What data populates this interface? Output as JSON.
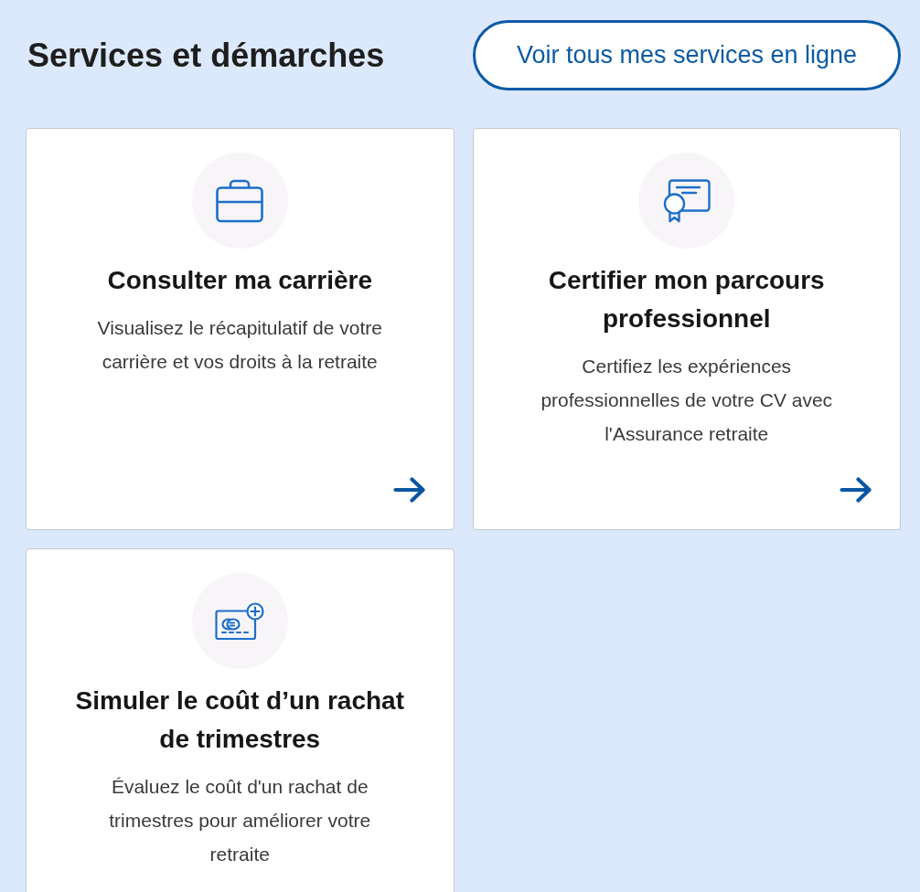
{
  "section": {
    "title": "Services et démarches",
    "all_services_button": "Voir tous mes services en ligne"
  },
  "cards": [
    {
      "kind": "career",
      "title": "Consulter ma carrière",
      "description": "Visualisez le récapitulatif de votre carrière et vos droits à la retraite",
      "arrow": true
    },
    {
      "kind": "certify",
      "title": "Certifier mon parcours professionnel",
      "description": "Certifiez les expériences professionnelles de votre CV avec l'Assurance retraite",
      "arrow": true
    },
    {
      "kind": "simulate",
      "title": "Simuler le coût d’un rachat de trimestres",
      "description": "Évaluez le coût d'un rachat de trimestres pour améliorer votre retraite",
      "arrow": false
    }
  ]
}
